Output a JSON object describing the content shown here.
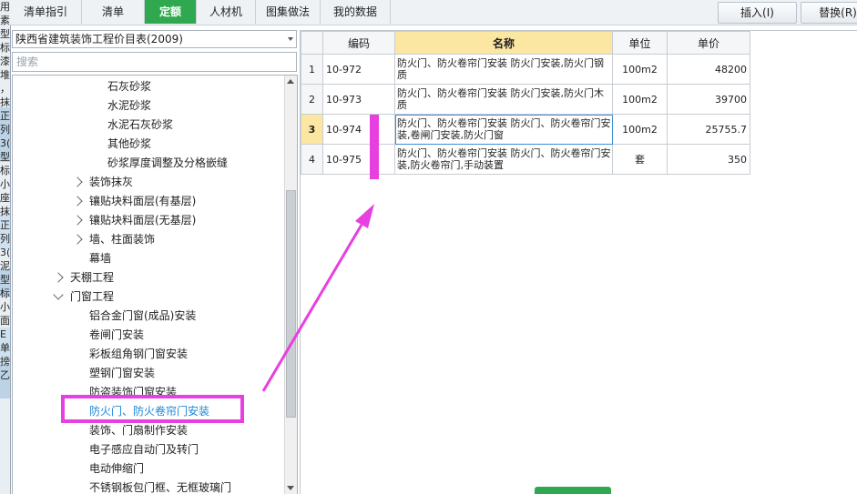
{
  "left_strip": {
    "chars": [
      "用",
      "素",
      "型",
      "标",
      "漆",
      "堆",
      "，",
      "抹",
      "正",
      "列",
      "3(",
      "型",
      "标",
      "小",
      "座",
      "抹",
      "正",
      "列",
      "3(",
      "泥",
      "型",
      "标",
      "小",
      "面",
      "E",
      "单",
      "搒",
      "乙3"
    ]
  },
  "tabs": [
    {
      "label": "清单指引"
    },
    {
      "label": "清单"
    },
    {
      "label": "定额"
    },
    {
      "label": "人材机"
    },
    {
      "label": "图集做法"
    },
    {
      "label": "我的数据"
    }
  ],
  "toolbar": {
    "insert_label": "插入(I)",
    "replace_label": "替换(R)"
  },
  "catalog": {
    "selected": "陕西省建筑装饰工程价目表(2009)"
  },
  "search": {
    "placeholder": "搜索"
  },
  "tree": [
    {
      "label": "石灰砂浆"
    },
    {
      "label": "水泥砂浆"
    },
    {
      "label": "水泥石灰砂浆"
    },
    {
      "label": "其他砂浆"
    },
    {
      "label": "砂浆厚度调整及分格嵌缝"
    },
    {
      "label": "装饰抹灰"
    },
    {
      "label": "镶贴块料面层(有基层)"
    },
    {
      "label": "镶贴块料面层(无基层)"
    },
    {
      "label": "墙、柱面装饰"
    },
    {
      "label": "幕墙"
    },
    {
      "label": "天棚工程"
    },
    {
      "label": "门窗工程"
    },
    {
      "label": "铝合金门窗(成品)安装"
    },
    {
      "label": "卷闸门安装"
    },
    {
      "label": "彩板组角钢门窗安装"
    },
    {
      "label": "塑钢门窗安装"
    },
    {
      "label": "防盗装饰门窗安装"
    },
    {
      "label": "防火门、防火卷帘门安装"
    },
    {
      "label": "装饰、门扇制作安装"
    },
    {
      "label": "电子感应自动门及转门"
    },
    {
      "label": "电动伸缩门"
    },
    {
      "label": "不锈钢板包门框、无框玻璃门"
    }
  ],
  "table": {
    "headers": {
      "code": "编码",
      "name": "名称",
      "unit": "单位",
      "price": "单价"
    },
    "rows": [
      {
        "idx": "1",
        "code": "10-972",
        "name": "防火门、防火卷帘门安装 防火门安装,防火门钢质",
        "unit": "100m2",
        "price": "48200"
      },
      {
        "idx": "2",
        "code": "10-973",
        "name": "防火门、防火卷帘门安装 防火门安装,防火门木质",
        "unit": "100m2",
        "price": "39700"
      },
      {
        "idx": "3",
        "code": "10-974",
        "name": "防火门、防火卷帘门安装 防火门、防火卷帘门安装,卷闸门安装,防火门窗",
        "unit": "100m2",
        "price": "25755.7"
      },
      {
        "idx": "4",
        "code": "10-975",
        "name": "防火门、防火卷帘门安装 防火门、防火卷帘门安装,防火卷帘门,手动装置",
        "unit": "套",
        "price": "350"
      }
    ]
  },
  "colors": {
    "active_tab": "#2fa84f",
    "header_highlight": "#fbe6a2",
    "selected_tree_text": "#1e86d6",
    "annotation": "#e83fe0"
  }
}
